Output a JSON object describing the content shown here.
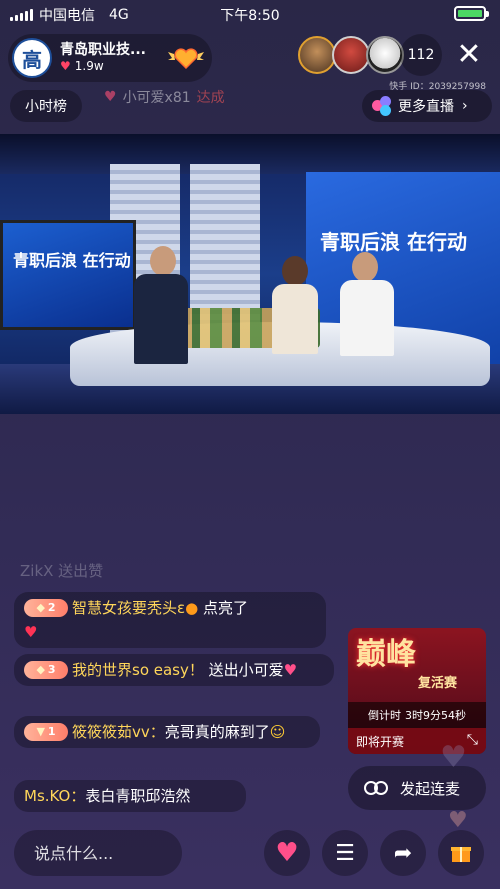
{
  "status_bar": {
    "carrier": "中国电信",
    "network": "4G",
    "time": "下午8:50"
  },
  "host": {
    "name": "青岛职业技...",
    "likes": "1.9w",
    "avatar_char": "高"
  },
  "viewers": {
    "count": "112"
  },
  "kuaishou_id": "快手 ID：2039257998",
  "hour_rank": "小时榜",
  "gift_notice": {
    "user": "小可爱x81",
    "status": "达成"
  },
  "more_live": "更多直播",
  "video": {
    "screen_left_title": "青职后浪 在行动",
    "screen_right_title": "青职后浪 在行动"
  },
  "chat": {
    "faded": "ZikX 送出赞",
    "messages": [
      {
        "level": "2",
        "user": "智慧女孩要秃头ε",
        "text": " 点亮了"
      },
      {
        "level": "3",
        "user": "我的世界so easy！",
        "text": "送出小可爱"
      },
      {
        "level": "1",
        "user": "筱筱筱茹vv：",
        "text": "亮哥真的麻到了"
      },
      {
        "level": "",
        "user": "Ms.KO：",
        "text": "表白青职邱浩然"
      }
    ]
  },
  "promo": {
    "title": "巅峰",
    "subtitle": "复活赛",
    "countdown_label": "倒计时",
    "countdown": "3时9分54秒",
    "footer": "即将开赛"
  },
  "connect_button": "发起连麦",
  "input": {
    "placeholder": "说点什么..."
  },
  "colors": {
    "accent": "#ffd65a",
    "level_badge": "#ff7e6a",
    "battery": "#4cd964"
  }
}
